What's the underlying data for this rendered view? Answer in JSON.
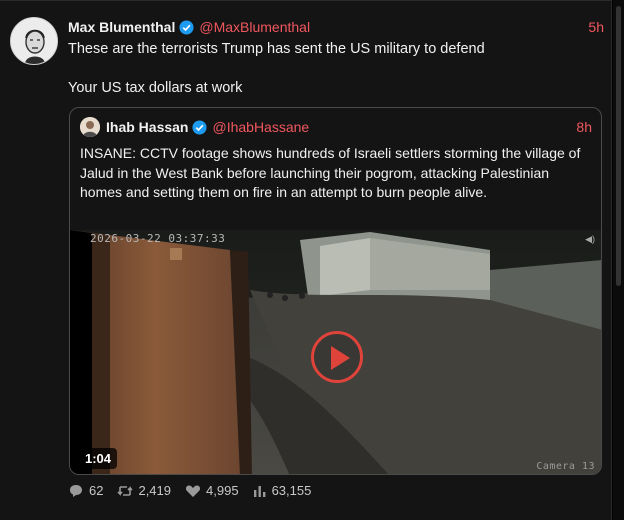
{
  "tweet": {
    "author_name": "Max Blumenthal",
    "author_handle": "@MaxBlumenthal",
    "time": "5h",
    "text_line1": "These are the terrorists Trump has sent the US military to defend",
    "text_line2": "Your US tax dollars at work"
  },
  "quoted": {
    "author_name": "Ihab Hassan",
    "author_handle": "@IhabHassane",
    "time": "8h",
    "text": "INSANE: CCTV footage shows hundreds of Israeli settlers storming the village of Jalud in the West Bank before launching their pogrom, attacking Palestinian homes and setting them on fire in an attempt to burn people alive.",
    "video": {
      "timestamp": "2026-03-22 03:37:33",
      "camera": "Camera 13",
      "duration": "1:04"
    }
  },
  "stats": {
    "replies": "62",
    "retweets": "2,419",
    "likes": "4,995",
    "views": "63,155"
  },
  "colors": {
    "accent": "#f0575f",
    "play": "#e0433a",
    "verified": "#1d9bf0"
  },
  "icons": [
    "verified-badge-icon",
    "reply-icon",
    "retweet-icon",
    "like-icon",
    "views-icon",
    "play-icon",
    "speaker-icon"
  ]
}
